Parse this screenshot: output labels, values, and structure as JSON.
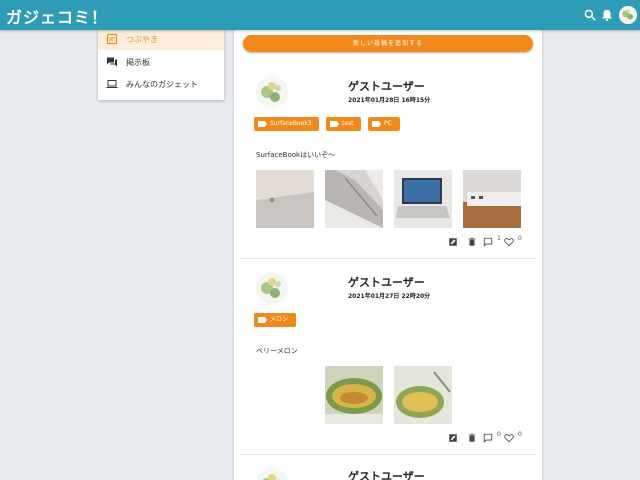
{
  "header": {
    "title": "ガジェコミ！",
    "icons": [
      "search-icon",
      "bell-icon",
      "avatar"
    ],
    "color": "#2e9cb6"
  },
  "sidebar": {
    "items": [
      {
        "label": "つぶやき",
        "icon": "post-icon",
        "active": true
      },
      {
        "label": "掲示板",
        "icon": "forum-icon",
        "active": false
      },
      {
        "label": "みんなのガジェット",
        "icon": "laptop-icon",
        "active": false
      }
    ]
  },
  "feed": {
    "add_button_label": "新しい投稿を追加する",
    "accent": "#f18a1c",
    "posts": [
      {
        "user": "ゲストユーザー",
        "date": "2021年01月28日 16時15分",
        "tags": [
          "SurfaceBook3",
          "test",
          "PC"
        ],
        "text": "SurfaceBookはいいぞ〜",
        "photos": 4,
        "comments": "1",
        "likes": "0"
      },
      {
        "user": "ゲストユーザー",
        "date": "2021年01月27日 22時20分",
        "tags": [
          "メロン"
        ],
        "text": "ベリーメロン",
        "photos": 2,
        "comments": "0",
        "likes": "0"
      },
      {
        "user": "ゲストユーザー"
      }
    ]
  }
}
